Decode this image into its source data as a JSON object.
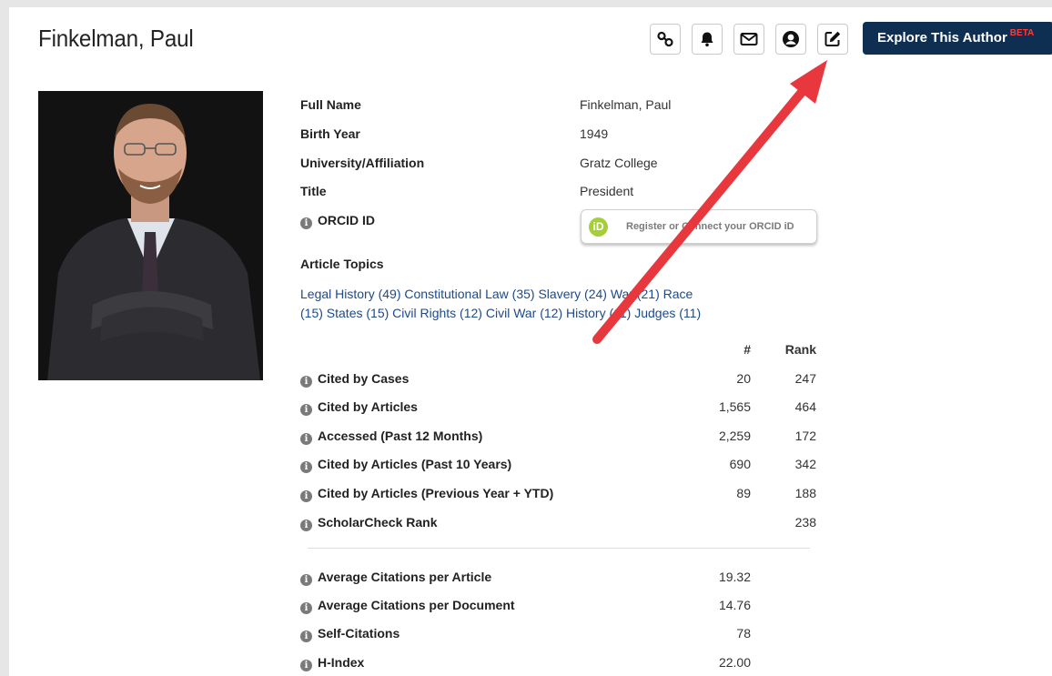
{
  "author": {
    "name": "Finkelman, Paul"
  },
  "toolbar": {
    "icons": [
      "link-icon",
      "bell-icon",
      "envelope-icon",
      "user-circle-icon",
      "edit-icon"
    ],
    "explore_label": "Explore This Author",
    "beta": "BETA"
  },
  "profile": {
    "full_name_label": "Full Name",
    "full_name": "Finkelman, Paul",
    "birth_year_label": "Birth Year",
    "birth_year": "1949",
    "affiliation_label": "University/Affiliation",
    "affiliation": "Gratz College",
    "title_label": "Title",
    "title": "President",
    "orcid_label": "ORCID ID",
    "orcid_logo": "iD",
    "orcid_button": "Register or Connect your ORCID iD"
  },
  "topics": {
    "label": "Article Topics",
    "items": [
      "Legal History (49)",
      "Constitutional Law (35)",
      "Slavery (24)",
      "War (21)",
      "Race",
      "(15) States (15)",
      "Civil Rights (12)",
      "Civil War (12)",
      "History (11)",
      "Judges (11)"
    ]
  },
  "stats": {
    "col_count": "#",
    "col_rank": "Rank",
    "rows": [
      {
        "label": "Cited by Cases",
        "count": "20",
        "rank": "247"
      },
      {
        "label": "Cited by Articles",
        "count": "1,565",
        "rank": "464"
      },
      {
        "label": "Accessed (Past 12 Months)",
        "count": "2,259",
        "rank": "172"
      },
      {
        "label": "Cited by Articles (Past 10 Years)",
        "count": "690",
        "rank": "342"
      },
      {
        "label": "Cited by Articles (Previous Year + YTD)",
        "count": "89",
        "rank": "188"
      },
      {
        "label": "ScholarCheck Rank",
        "count": "",
        "rank": "238"
      }
    ]
  },
  "metrics": {
    "rows": [
      {
        "label": "Average Citations per Article",
        "value": "19.32"
      },
      {
        "label": "Average Citations per Document",
        "value": "14.76"
      },
      {
        "label": "Self-Citations",
        "value": "78"
      },
      {
        "label": "H-Index",
        "value": "22.00"
      }
    ]
  },
  "colors": {
    "navy": "#0f2f52",
    "link": "#1d4a8a",
    "beta": "#ff3b3b",
    "orcid": "#a6ce39",
    "arrow": "#e8383d"
  }
}
